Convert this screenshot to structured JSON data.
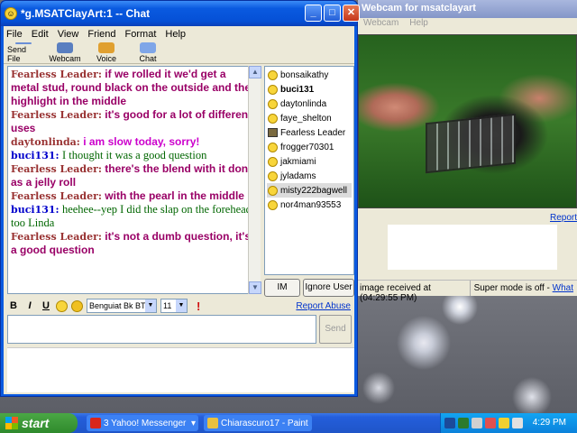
{
  "chat": {
    "title": "*g.MSATClayArt:1 -- Chat",
    "menu": [
      "File",
      "Edit",
      "View",
      "Friend",
      "Format",
      "Help"
    ],
    "toolbar": [
      "Send File",
      "Webcam",
      "Voice",
      "Chat"
    ],
    "messages": [
      {
        "who": "Fearless Leader:",
        "text": "if we rolled it we'd get a metal stud, round black on the outside and the highlight in the middle",
        "who_color": "#993333",
        "text_color": "#990066",
        "serif": false
      },
      {
        "who": "Fearless Leader:",
        "text": "it's good for a lot of different uses",
        "who_color": "#993333",
        "text_color": "#990066",
        "serif": false
      },
      {
        "who": "daytonlinda:",
        "text": "i am slow today, sorry!",
        "who_color": "#993333",
        "text_color": "#cc00cc",
        "serif": false
      },
      {
        "who": "buci131:",
        "text": "I thought it was a good question",
        "who_color": "#0000cc",
        "text_color": "#006600",
        "serif": true
      },
      {
        "who": "Fearless Leader:",
        "text": "there's the blend with it done as a jelly roll",
        "who_color": "#993333",
        "text_color": "#990066",
        "serif": false
      },
      {
        "who": "Fearless Leader:",
        "text": "with the pearl in the middle",
        "who_color": "#993333",
        "text_color": "#990066",
        "serif": false
      },
      {
        "who": "buci131:",
        "text": "heehee--yep I did the slap on the forehead, too Linda",
        "who_color": "#0000cc",
        "text_color": "#006600",
        "serif": true
      },
      {
        "who": "Fearless Leader:",
        "text": "it's not a dumb question, it's a good question",
        "who_color": "#993333",
        "text_color": "#990066",
        "serif": false
      }
    ],
    "users": [
      {
        "name": "bonsaikathy",
        "bold": false,
        "icon": "smile"
      },
      {
        "name": "buci131",
        "bold": true,
        "icon": "smile"
      },
      {
        "name": "daytonlinda",
        "bold": false,
        "icon": "smile"
      },
      {
        "name": "faye_shelton",
        "bold": false,
        "icon": "smile"
      },
      {
        "name": "Fearless Leader",
        "bold": false,
        "icon": "cam"
      },
      {
        "name": "frogger70301",
        "bold": false,
        "icon": "smile"
      },
      {
        "name": "jakmiami",
        "bold": false,
        "icon": "smile"
      },
      {
        "name": "jyladams",
        "bold": false,
        "icon": "smile"
      },
      {
        "name": "misty222bagwell",
        "bold": false,
        "icon": "smile",
        "selected": true
      },
      {
        "name": "nor4man93553",
        "bold": false,
        "icon": "smile"
      }
    ],
    "im_label": "IM",
    "ignore_label": "Ignore User",
    "format": {
      "bold": "B",
      "italic": "I",
      "underline": "U",
      "font": "Benguiat Bk BT",
      "size": "11"
    },
    "report_abuse": "Report Abuse",
    "send_label": "Send"
  },
  "webcam": {
    "title": "Webcam for msatclayart",
    "menu": [
      "Webcam",
      "Help"
    ],
    "report": "Report",
    "status_received": "image received at (04:29:55 PM)",
    "status_super": "Super mode is off -",
    "status_link": "What"
  },
  "taskbar": {
    "start": "start",
    "tasks": [
      "3 Yahoo! Messenger",
      "Chiarascuro17 - Paint"
    ],
    "clock": "4:29 PM"
  }
}
